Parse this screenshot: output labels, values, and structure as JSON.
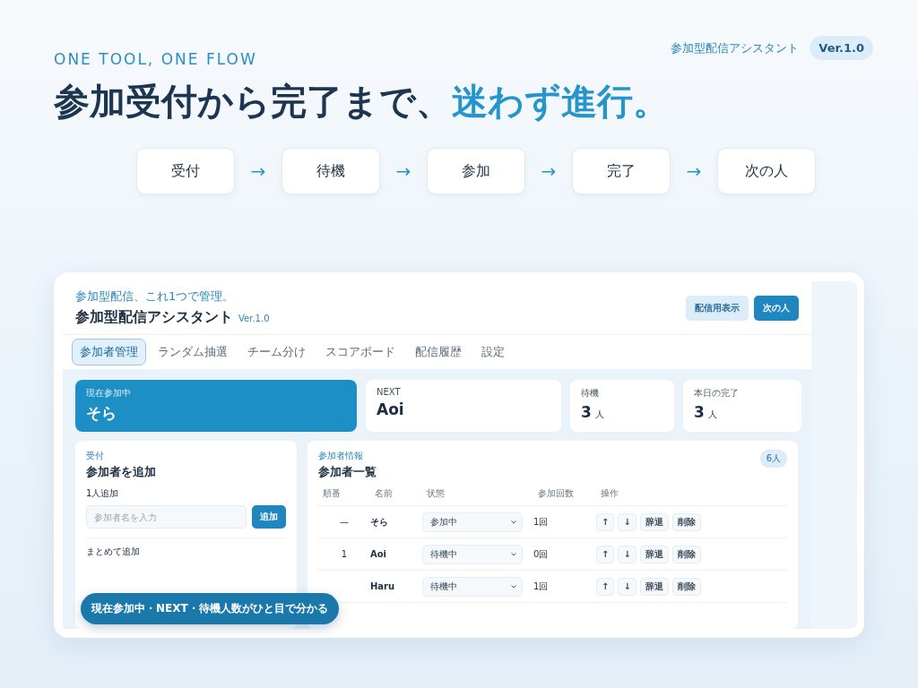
{
  "brand": {
    "name": "参加型配信アシスタント",
    "version": "Ver.1.0"
  },
  "eyebrow": "ONE TOOL, ONE FLOW",
  "headline": {
    "text": "参加受付から完了まで、",
    "accent": "迷わず進行。"
  },
  "flow": {
    "arrow": "→",
    "steps": [
      "受付",
      "待機",
      "参加",
      "完了",
      "次の人"
    ]
  },
  "app": {
    "tagline": "参加型配信、これ1つで管理。",
    "title": "参加型配信アシスタント",
    "version": "Ver.1.0",
    "actions": [
      {
        "label": "配信用表示",
        "kind": "secondary"
      },
      {
        "label": "次の人",
        "kind": "primary"
      }
    ],
    "tabs": [
      {
        "label": "参加者管理",
        "selected": true
      },
      {
        "label": "ランダム抽選",
        "selected": false
      },
      {
        "label": "チーム分け",
        "selected": false
      },
      {
        "label": "スコアボード",
        "selected": false
      },
      {
        "label": "配信履歴",
        "selected": false
      },
      {
        "label": "設定",
        "selected": false
      }
    ],
    "stats": [
      {
        "label": "現在参加中",
        "value": "そら",
        "kind": "current"
      },
      {
        "label": "NEXT",
        "value": "Aoi",
        "kind": "plain"
      },
      {
        "label": "待機",
        "value": "3",
        "unit": "人",
        "kind": "plain"
      },
      {
        "label": "本日の完了",
        "value": "3",
        "unit": "人",
        "kind": "plain"
      }
    ],
    "add_panel": {
      "eyebrow": "受付",
      "title": "参加者を追加",
      "single_label": "1人追加",
      "placeholder": "参加者名を入力",
      "add_button": "追加",
      "bulk_label": "まとめて追加"
    },
    "list_panel": {
      "eyebrow": "参加者情報",
      "title": "参加者一覧",
      "count": "6人",
      "columns": [
        "順番",
        "名前",
        "状態",
        "参加回数",
        "操作"
      ],
      "rows": [
        {
          "order": "—",
          "name": "そら",
          "status": "参加中",
          "count": "1回",
          "actions": [
            "↑",
            "↓",
            "辞退",
            "削除"
          ]
        },
        {
          "order": "1",
          "name": "Aoi",
          "status": "待機中",
          "count": "0回",
          "actions": [
            "↑",
            "↓",
            "辞退",
            "削除"
          ]
        },
        {
          "name": "Haru",
          "status": "待機中",
          "count": "1回",
          "actions": [
            "↑",
            "↓",
            "辞退",
            "削除"
          ]
        }
      ]
    }
  },
  "callout": "現在参加中・NEXT・待機人数がひと目で分かる"
}
